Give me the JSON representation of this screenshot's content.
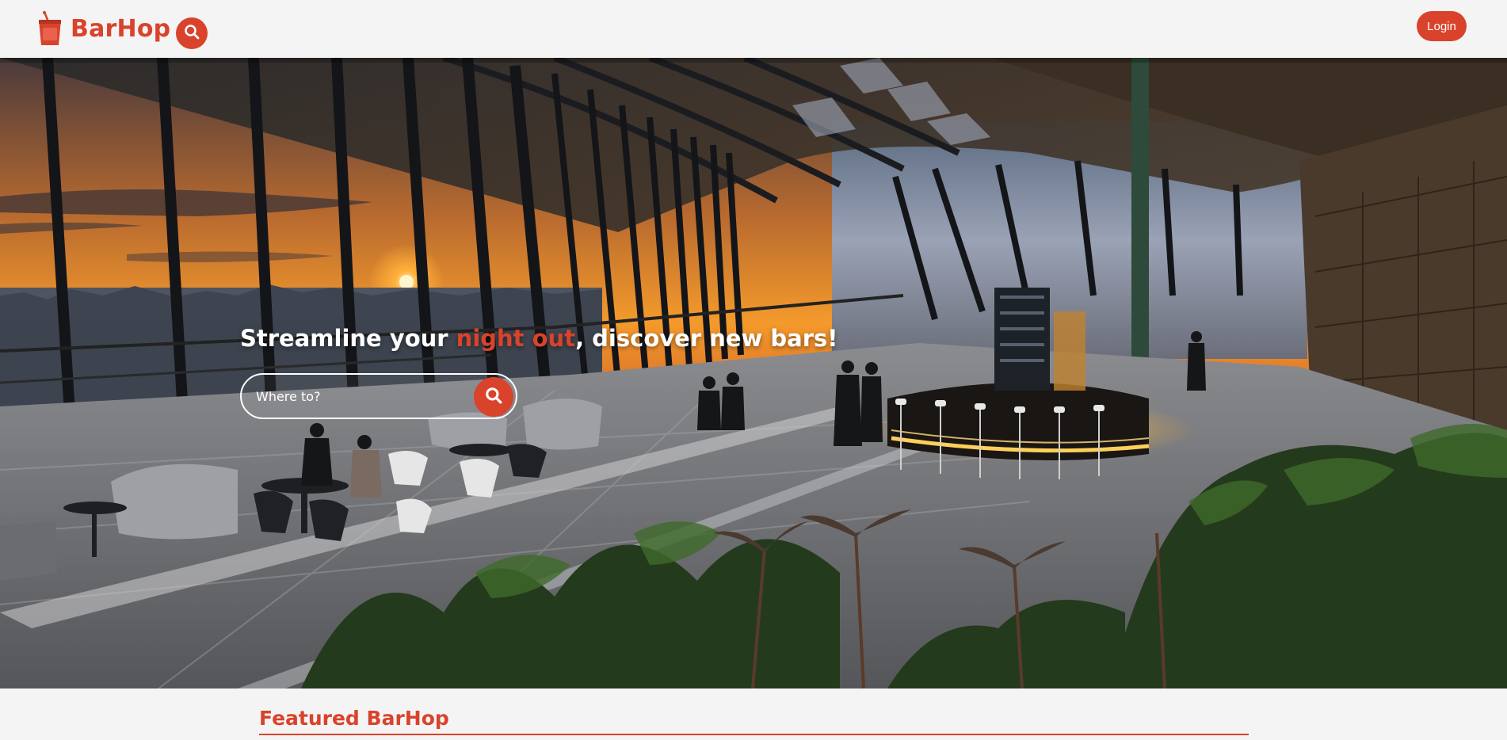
{
  "brand": {
    "name": "BarHop",
    "accent_color": "#d9432b",
    "logo_icon": "cup-icon"
  },
  "header": {
    "search_icon": "search-icon",
    "login_label": "Login"
  },
  "hero": {
    "title_before": "Streamline your ",
    "title_accent": "night out",
    "title_after": ", discover new bars!",
    "search_placeholder": "Where to?",
    "search_value": "",
    "search_button_icon": "search-icon",
    "background": "rooftop-bar-sunset-photo"
  },
  "featured": {
    "title": "Featured BarHop"
  }
}
